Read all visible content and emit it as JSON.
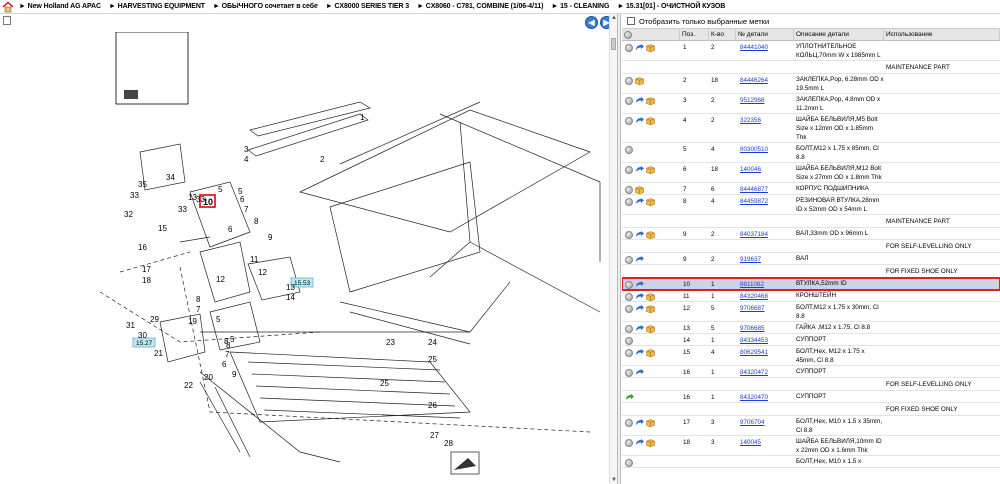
{
  "breadcrumb": [
    "New Holland AG APAC",
    "HARVESTING EQUIPMENT",
    "ОБЫЧНОГО сочетает в себе",
    "CX8000 SERIES TIER 3",
    "CX8060 - C781, COMBINE (1/06-4/11)",
    "15 - CLEANING",
    "15.31[01] - ОЧИСТНОЙ КУЗОВ"
  ],
  "nav": {
    "back_glyph": "◀",
    "forward_glyph": "▶"
  },
  "filter": {
    "label": "Отобразить только выбранные метки"
  },
  "columns": [
    "Поз.",
    "К-во",
    "№ детали",
    "Описание детали",
    "Использование"
  ],
  "rows": [
    {
      "pos": "1",
      "qty": "2",
      "part": "84441040",
      "desc": "УПЛОТНИТЕЛЬНОЕ КОЛЬЦ,70mm W x 1985mm L",
      "use": "",
      "icons": [
        "gear",
        "arrow",
        "box"
      ]
    },
    {
      "note": "MAINTENANCE PART"
    },
    {
      "pos": "2",
      "qty": "18",
      "part": "84446264",
      "desc": "ЗАКЛЕПКА,Pop, 6.28mm OD x 19.5mm L",
      "use": "",
      "icons": [
        "gear",
        "box"
      ]
    },
    {
      "pos": "3",
      "qty": "2",
      "part": "9512968",
      "desc": "ЗАКЛЕПКА,Pop, 4.8mm OD x 11.2mm L",
      "use": "",
      "icons": [
        "gear",
        "arrow",
        "box"
      ]
    },
    {
      "pos": "4",
      "qty": "2",
      "part": "322356",
      "desc": "ШАЙБА БЕЛЬВИЛЯ,M5 Bolt Size x 12mm OD x 1.85mm Thk",
      "use": "",
      "icons": [
        "gear",
        "arrow",
        "box"
      ]
    },
    {
      "pos": "5",
      "qty": "4",
      "part": "80300510",
      "desc": "БОЛТ,M12 x 1.75 x 85mm, Cl 8.8",
      "use": "",
      "icons": [
        "gear"
      ]
    },
    {
      "pos": "6",
      "qty": "18",
      "part": "140046",
      "desc": "ШАЙБА БЕЛЬВИЛЯ,M12 Bolt Size x 27mm OD x 1.8mm Thk",
      "use": "",
      "icons": [
        "gear",
        "arrow",
        "box"
      ]
    },
    {
      "pos": "7",
      "qty": "6",
      "part": "84446877",
      "desc": "КОРПУС ПОДШИПНИКА",
      "use": "",
      "icons": [
        "gear",
        "box"
      ]
    },
    {
      "pos": "8",
      "qty": "4",
      "part": "84459872",
      "desc": "РЕЗИНОВАЯ ВТУЛКА,28mm ID x 52mm OD x 54mm L",
      "use": "",
      "icons": [
        "gear",
        "arrow",
        "box"
      ]
    },
    {
      "note": "MAINTENANCE PART"
    },
    {
      "pos": "9",
      "qty": "2",
      "part": "84037184",
      "desc": "ВАЛ,33mm OD x 96mm L",
      "use": "",
      "icons": [
        "gear",
        "arrow",
        "box"
      ]
    },
    {
      "note": "FOR SELF-LEVELLING ONLY"
    },
    {
      "pos": "9",
      "qty": "2",
      "part": "919637",
      "desc": "ВАЛ",
      "use": "",
      "icons": [
        "gear",
        "arrow"
      ]
    },
    {
      "note": "FOR FIXED SHOE ONLY"
    },
    {
      "pos": "10",
      "qty": "1",
      "part": "8811062",
      "desc": "ВТУЛКА,52mm ID",
      "use": "",
      "icons": [
        "gear",
        "arrow"
      ],
      "selected": true
    },
    {
      "pos": "11",
      "qty": "1",
      "part": "84320468",
      "desc": "КРОНШТЕЙН",
      "use": "",
      "icons": [
        "gear",
        "arrow",
        "box"
      ]
    },
    {
      "pos": "12",
      "qty": "5",
      "part": "9706687",
      "desc": "БОЛТ,M12 x 1.75 x 30mm, Cl 8.8",
      "use": "",
      "icons": [
        "gear",
        "arrow",
        "box"
      ]
    },
    {
      "pos": "13",
      "qty": "5",
      "part": "9706685",
      "desc": "ГАЙКА ,M12 x 1.75, Cl 8.8",
      "use": "",
      "icons": [
        "gear",
        "arrow",
        "box"
      ]
    },
    {
      "pos": "14",
      "qty": "1",
      "part": "84334453",
      "desc": "СУППОРТ",
      "use": "",
      "icons": [
        "gear"
      ]
    },
    {
      "pos": "15",
      "qty": "4",
      "part": "80629541",
      "desc": "БОЛТ,Hex, M12 x 1.75 x 45mm, Cl 8.8",
      "use": "",
      "icons": [
        "gear",
        "arrow",
        "box"
      ]
    },
    {
      "pos": "16",
      "qty": "1",
      "part": "84320472",
      "desc": "СУППОРТ",
      "use": "",
      "icons": [
        "gear",
        "arrow"
      ]
    },
    {
      "note": "FOR SELF-LEVELLING ONLY"
    },
    {
      "pos": "16",
      "qty": "1",
      "part": "84320470",
      "desc": "СУППОРТ",
      "use": "",
      "icons": [
        "green-arrow"
      ]
    },
    {
      "note": "FOR FIXED SHOE ONLY"
    },
    {
      "pos": "17",
      "qty": "3",
      "part": "9706704",
      "desc": "БОЛТ,Hex, M10 x 1.5 x 35mm, Cl 8.8",
      "use": "",
      "icons": [
        "gear",
        "arrow",
        "box"
      ]
    },
    {
      "pos": "18",
      "qty": "3",
      "part": "140045",
      "desc": "ШАЙБА БЕЛЬВИЛЯ,10mm ID x 22mm OD x 1.6mm Thk",
      "use": "",
      "icons": [
        "gear",
        "arrow",
        "box"
      ]
    },
    {
      "pos": "",
      "qty": "",
      "part": "",
      "desc": "БОЛТ,Hex, M10 x 1.5 x",
      "use": "",
      "icons": [
        "gear"
      ]
    }
  ],
  "diagram": {
    "callouts": [
      "1",
      "2",
      "3",
      "4",
      "5",
      "6",
      "7",
      "8",
      "9",
      "10",
      "11",
      "12",
      "13",
      "14",
      "15",
      "16",
      "17",
      "18",
      "19",
      "20",
      "21",
      "22",
      "23",
      "24",
      "25",
      "26",
      "27",
      "28",
      "29",
      "30",
      "31",
      "32",
      "33",
      "34",
      "35"
    ],
    "refs": [
      "15.53",
      "15.27"
    ],
    "highlight": "10"
  },
  "colors": {
    "accent": "#3a7bd5",
    "highlight": "#e02020",
    "link": "#1a3fd0"
  }
}
